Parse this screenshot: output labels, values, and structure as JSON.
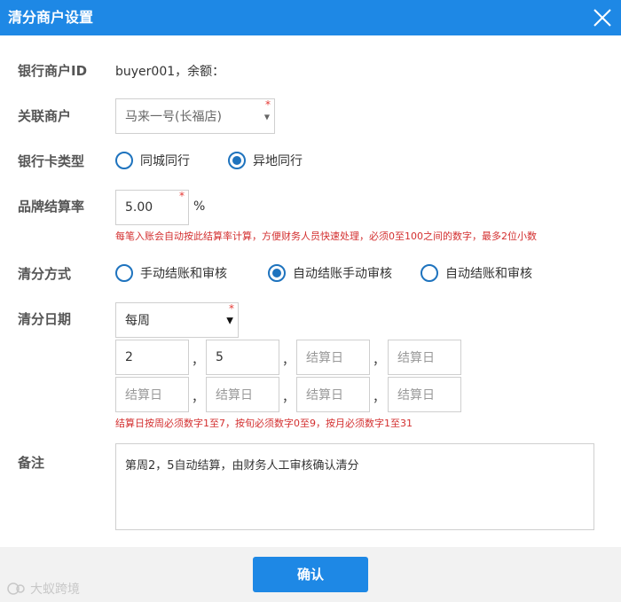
{
  "dialog": {
    "title": "清分商户设置"
  },
  "bank_merchant": {
    "label": "银行商户ID",
    "value": "buyer001，余额："
  },
  "merchant": {
    "label": "关联商户",
    "selected": "马来一号(长福店)"
  },
  "card_type": {
    "label": "银行卡类型",
    "options": [
      {
        "label": "同城同行",
        "checked": false
      },
      {
        "label": "异地同行",
        "checked": true
      }
    ]
  },
  "rate": {
    "label": "品牌结算率",
    "value": "5.00",
    "unit": "%",
    "hint": "每笔入账会自动按此结算率计算，方便财务人员快速处理，必须0至100之间的数字，最多2位小数"
  },
  "method": {
    "label": "清分方式",
    "options": [
      {
        "label": "手动结账和审核",
        "checked": false
      },
      {
        "label": "自动结账手动审核",
        "checked": true
      },
      {
        "label": "自动结账和审核",
        "checked": false
      }
    ]
  },
  "date": {
    "label": "清分日期",
    "period": "每周",
    "sep": "，",
    "day_placeholder": "结算日",
    "days": [
      "2",
      "5",
      "",
      "",
      "",
      "",
      "",
      ""
    ],
    "hint": "结算日按周必须数字1至7，按旬必须数字0至9，按月必须数字1至31"
  },
  "remark": {
    "label": "备注",
    "value": "第周2，5自动结算，由财务人工审核确认清分"
  },
  "footer": {
    "confirm_label": "确认",
    "watermark": "大蚁跨境"
  },
  "colors": {
    "primary": "#1e88e5",
    "radio": "#1e73be",
    "required": "#e53935",
    "hint": "#d32f2f"
  }
}
